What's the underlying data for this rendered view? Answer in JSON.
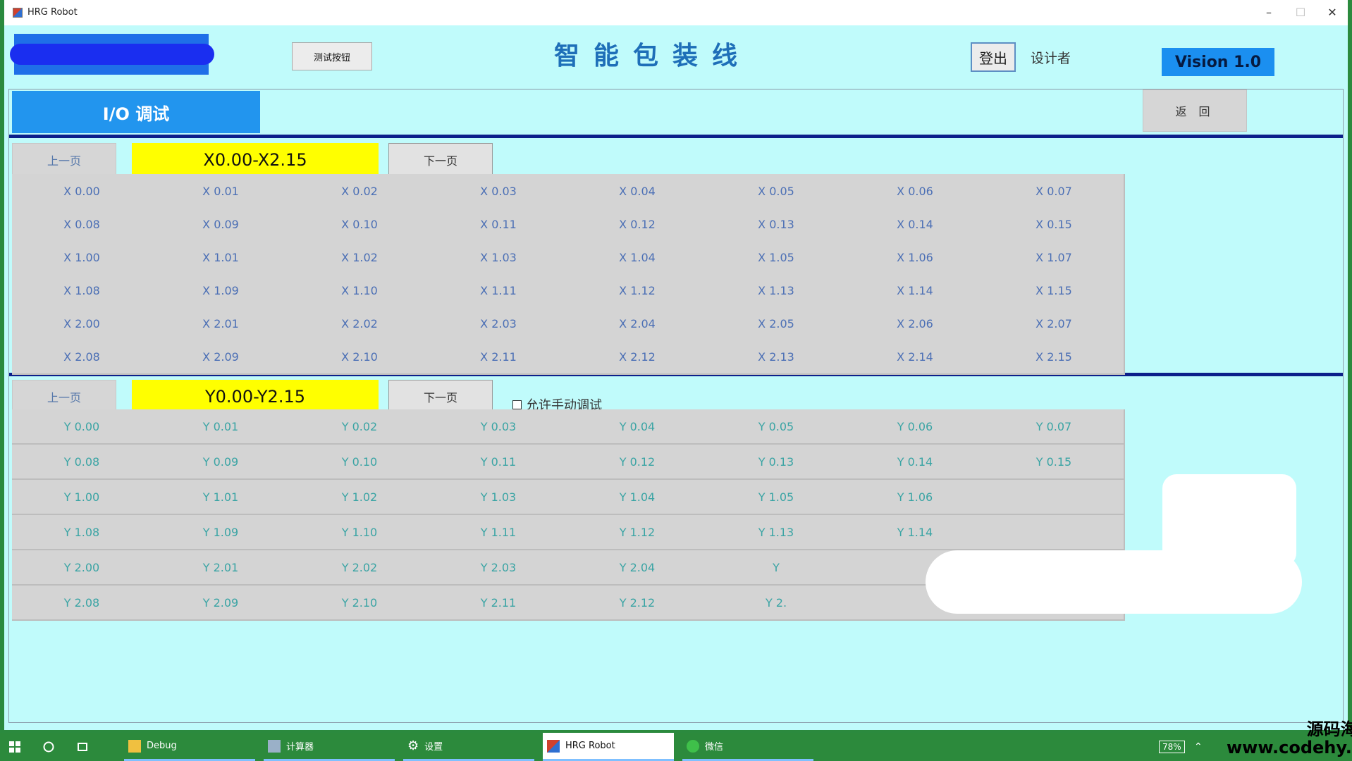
{
  "window": {
    "title": "HRG Robot",
    "controls": {
      "minimize": "–",
      "maximize": "☐",
      "close": "✕"
    }
  },
  "header": {
    "test_button": "测试按钮",
    "app_title": "智能包装线",
    "logout": "登出",
    "designer": "设计者",
    "version": "Vision 1.0"
  },
  "panel": {
    "tab_label": "I/O 调试",
    "back_button": "返 回",
    "x_section": {
      "prev": "上一页",
      "range": "X0.00-X2.15",
      "next": "下一页",
      "items": [
        "X 0.00",
        "X 0.01",
        "X 0.02",
        "X 0.03",
        "X 0.04",
        "X 0.05",
        "X 0.06",
        "X 0.07",
        "X 0.08",
        "X 0.09",
        "X 0.10",
        "X 0.11",
        "X 0.12",
        "X 0.13",
        "X 0.14",
        "X 0.15",
        "X 1.00",
        "X 1.01",
        "X 1.02",
        "X 1.03",
        "X 1.04",
        "X 1.05",
        "X 1.06",
        "X 1.07",
        "X 1.08",
        "X 1.09",
        "X 1.10",
        "X 1.11",
        "X 1.12",
        "X 1.13",
        "X 1.14",
        "X 1.15",
        "X 2.00",
        "X 2.01",
        "X 2.02",
        "X 2.03",
        "X 2.04",
        "X 2.05",
        "X 2.06",
        "X 2.07",
        "X 2.08",
        "X 2.09",
        "X 2.10",
        "X 2.11",
        "X 2.12",
        "X 2.13",
        "X 2.14",
        "X 2.15"
      ]
    },
    "y_section": {
      "prev": "上一页",
      "range": "Y0.00-Y2.15",
      "next": "下一页",
      "manual_debug": "允许手动调试",
      "items": [
        "Y 0.00",
        "Y 0.01",
        "Y 0.02",
        "Y 0.03",
        "Y 0.04",
        "Y 0.05",
        "Y 0.06",
        "Y 0.07",
        "Y 0.08",
        "Y 0.09",
        "Y 0.10",
        "Y 0.11",
        "Y 0.12",
        "Y 0.13",
        "Y 0.14",
        "Y 0.15",
        "Y 1.00",
        "Y 1.01",
        "Y 1.02",
        "Y 1.03",
        "Y 1.04",
        "Y 1.05",
        "Y 1.06",
        "",
        "Y 1.08",
        "Y 1.09",
        "Y 1.10",
        "Y 1.11",
        "Y 1.12",
        "Y 1.13",
        "Y 1.14",
        "",
        "Y 2.00",
        "Y 2.01",
        "Y 2.02",
        "Y 2.03",
        "Y 2.04",
        "Y",
        "",
        "",
        "Y 2.08",
        "Y 2.09",
        "Y 2.10",
        "Y 2.11",
        "Y 2.12",
        "Y 2.",
        "",
        ""
      ]
    }
  },
  "taskbar": {
    "items": [
      {
        "label": "Debug",
        "icon": "folder-icon"
      },
      {
        "label": "计算器",
        "icon": "calculator-icon"
      },
      {
        "label": "设置",
        "icon": "gear-icon"
      },
      {
        "label": "HRG Robot",
        "icon": "app-icon"
      },
      {
        "label": "微信",
        "icon": "wechat-icon"
      }
    ],
    "battery": "78%"
  },
  "watermark": {
    "line1": "源码海洋网",
    "line2": "www.codehy.com"
  },
  "colors": {
    "background": "#c0fbfb",
    "accent": "#2295ee",
    "range_highlight": "#ffff00",
    "divider": "#0c1f8a"
  }
}
